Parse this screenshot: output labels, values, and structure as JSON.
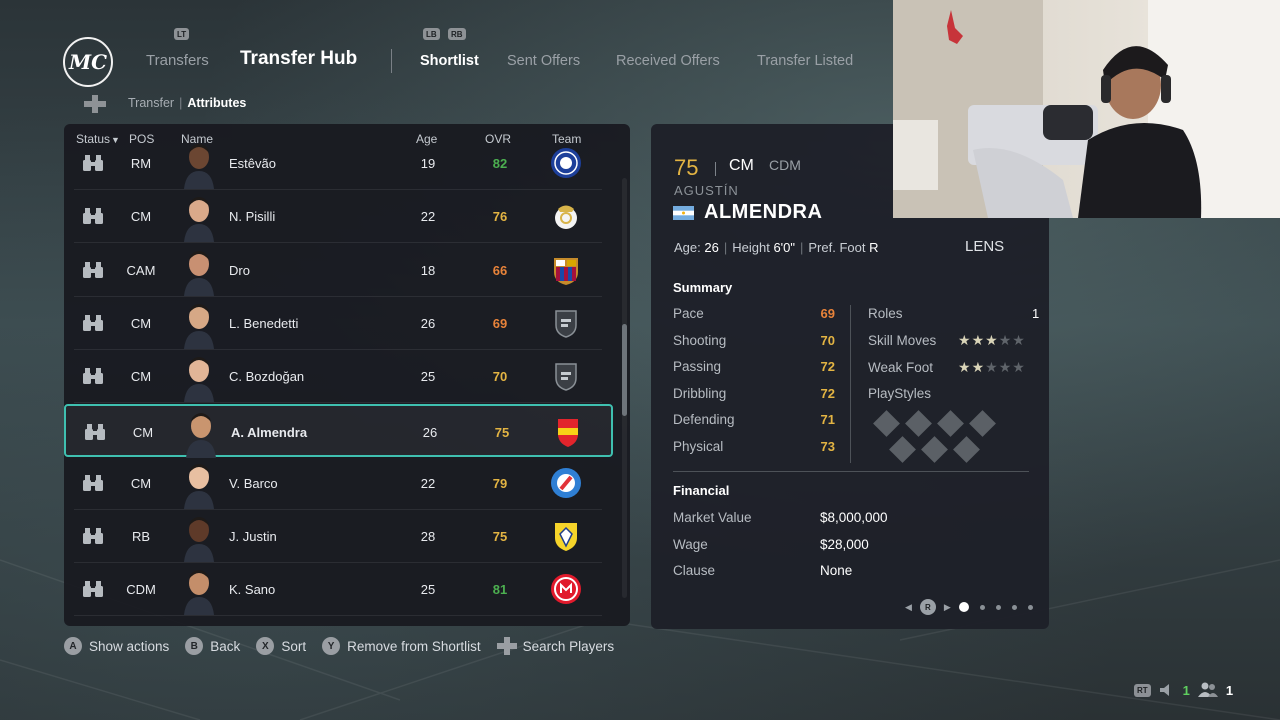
{
  "header": {
    "logo": "MC",
    "bumper_left": "LT",
    "transfers_label": "Transfers",
    "title": "Transfer Hub",
    "bumper_lb": "LB",
    "bumper_rb": "RB",
    "tabs": [
      {
        "label": "Shortlist",
        "active": true
      },
      {
        "label": "Sent Offers",
        "active": false
      },
      {
        "label": "Received Offers",
        "active": false
      },
      {
        "label": "Transfer Listed",
        "active": false
      }
    ]
  },
  "breadcrumb": {
    "parent": "Transfer",
    "current": "Attributes"
  },
  "list": {
    "columns": {
      "status": "Status",
      "pos": "POS",
      "name": "Name",
      "age": "Age",
      "ovr": "OVR",
      "team": "Team"
    },
    "sort_indicator": "▼",
    "rows": [
      {
        "pos": "RM",
        "name": "Estêvão",
        "age": "19",
        "ovr": "82",
        "ovr_color": "#4caf50",
        "team_icon": "chelsea-crest-icon"
      },
      {
        "pos": "CM",
        "name": "N. Pisilli",
        "age": "22",
        "ovr": "76",
        "ovr_color": "#e3b443",
        "team_icon": "real-madrid-crest-icon"
      },
      {
        "pos": "CAM",
        "name": "Dro",
        "age": "18",
        "ovr": "66",
        "ovr_color": "#e8833a",
        "team_icon": "barcelona-crest-icon"
      },
      {
        "pos": "CM",
        "name": "L. Benedetti",
        "age": "26",
        "ovr": "69",
        "ovr_color": "#e8833a",
        "team_icon": "generic-club-crest-icon"
      },
      {
        "pos": "CM",
        "name": "C. Bozdoğan",
        "age": "25",
        "ovr": "70",
        "ovr_color": "#e3b443",
        "team_icon": "generic-club-crest-icon"
      },
      {
        "pos": "CM",
        "name": "A. Almendra",
        "age": "26",
        "ovr": "75",
        "ovr_color": "#e3b443",
        "team_icon": "lens-crest-icon",
        "selected": true
      },
      {
        "pos": "CM",
        "name": "V. Barco",
        "age": "22",
        "ovr": "79",
        "ovr_color": "#e3b443",
        "team_icon": "strasbourg-crest-icon"
      },
      {
        "pos": "RB",
        "name": "J. Justin",
        "age": "28",
        "ovr": "75",
        "ovr_color": "#e3b443",
        "team_icon": "leeds-crest-icon"
      },
      {
        "pos": "CDM",
        "name": "K. Sano",
        "age": "25",
        "ovr": "81",
        "ovr_color": "#4caf50",
        "team_icon": "mainz-crest-icon"
      }
    ]
  },
  "player": {
    "ovr": "75",
    "position": "CM",
    "alt_position": "CDM",
    "first_name": "AGUSTÍN",
    "last_name": "ALMENDRA",
    "nationality_flag": "argentina-flag-icon",
    "age_label": "Age:",
    "age": "26",
    "height_label": "Height",
    "height": "6'0\"",
    "foot_label": "Pref. Foot",
    "foot": "R",
    "club": "LENS",
    "summary_title": "Summary",
    "stats": [
      {
        "label": "Pace",
        "value": "69",
        "color": "#e8833a"
      },
      {
        "label": "Shooting",
        "value": "70",
        "color": "#e3b443"
      },
      {
        "label": "Passing",
        "value": "72",
        "color": "#e3b443"
      },
      {
        "label": "Dribbling",
        "value": "72",
        "color": "#e3b443"
      },
      {
        "label": "Defending",
        "value": "71",
        "color": "#e3b443"
      },
      {
        "label": "Physical",
        "value": "73",
        "color": "#e3b443"
      }
    ],
    "roles_label": "Roles",
    "roles_value": "1",
    "skill_moves_label": "Skill Moves",
    "skill_moves": 3,
    "weak_foot_label": "Weak Foot",
    "weak_foot": 2,
    "star_max": 5,
    "playstyles_label": "PlayStyles",
    "financial_title": "Financial",
    "financial": [
      {
        "label": "Market Value",
        "value": "$8,000,000"
      },
      {
        "label": "Wage",
        "value": "$28,000"
      },
      {
        "label": "Clause",
        "value": "None"
      }
    ],
    "pager_button": "R",
    "page_current": 1,
    "page_count": 5
  },
  "footer": {
    "actions": [
      {
        "button": "A",
        "label": "Show actions"
      },
      {
        "button": "B",
        "label": "Back"
      },
      {
        "button": "X",
        "label": "Sort"
      },
      {
        "button": "Y",
        "label": "Remove from Shortlist"
      },
      {
        "button": "dpad",
        "label": "Search Players"
      }
    ]
  },
  "status": {
    "rt": "RT",
    "speaker_count": "1",
    "party_count": "1"
  },
  "colors": {
    "accent": "#3fc0b0",
    "green_rating": "#4caf50",
    "gold_rating": "#e3b443",
    "orange_rating": "#e8833a"
  }
}
